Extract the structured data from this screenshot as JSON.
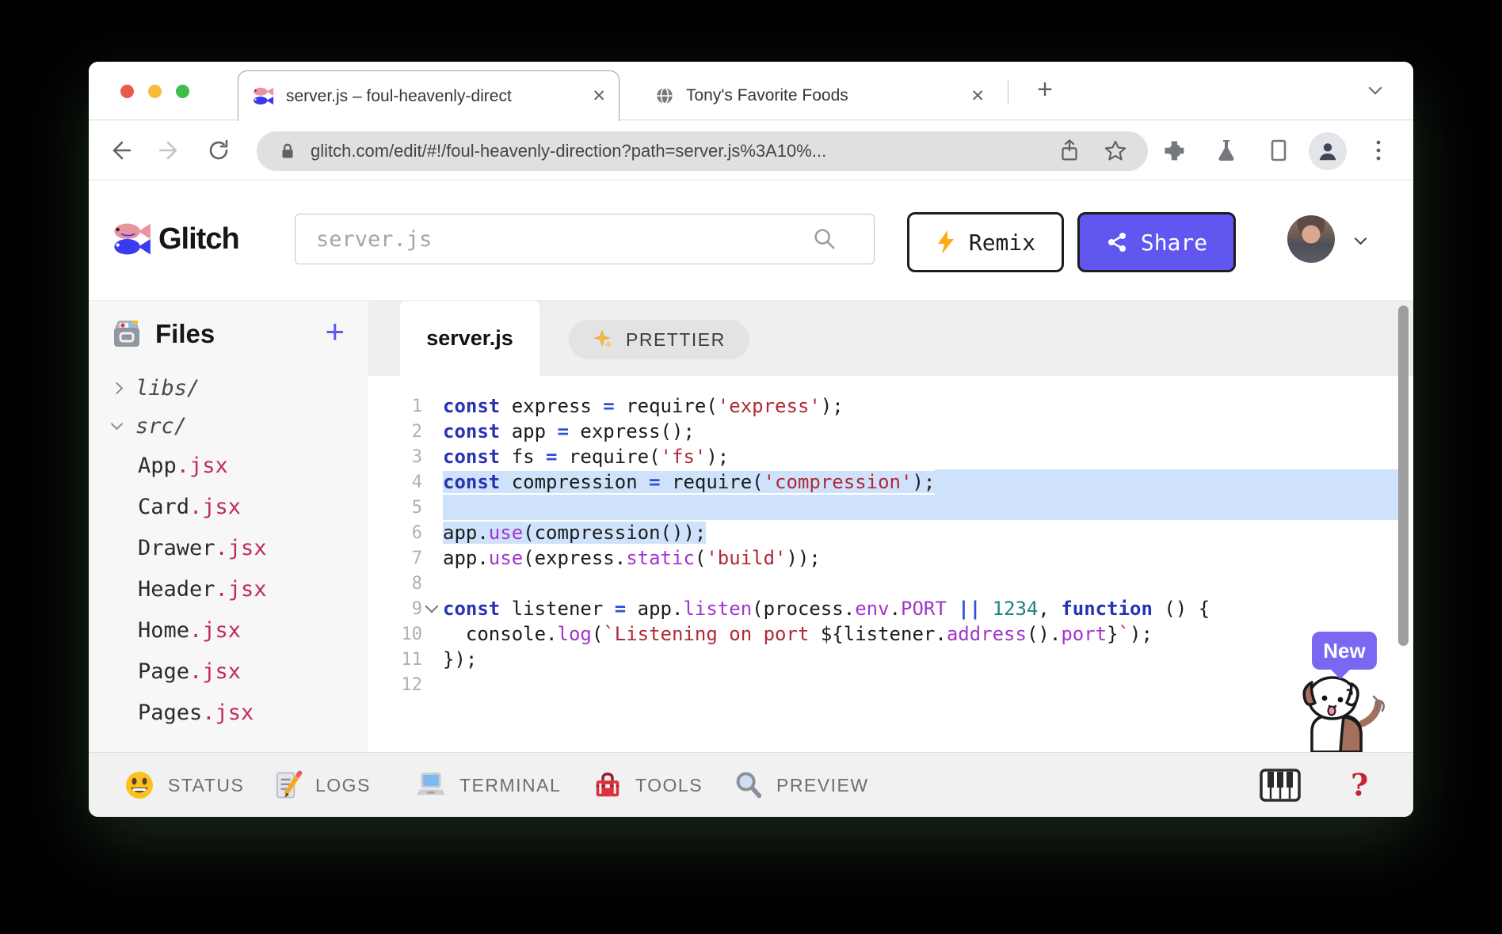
{
  "browser": {
    "tabs": [
      {
        "title": "server.js – foul-heavenly-direct",
        "active": true,
        "icon": "glitch-fish-favicon"
      },
      {
        "title": "Tony's Favorite Foods",
        "active": false,
        "icon": "globe-icon"
      }
    ],
    "close_glyph": "✕",
    "new_tab_glyph": "+",
    "url": "glitch.com/edit/#!/foul-heavenly-direction?path=server.js%3A10%..."
  },
  "header": {
    "logo_text": "Glitch",
    "search_value": "server.js",
    "remix_label": "Remix",
    "share_label": "Share"
  },
  "sidebar": {
    "title": "Files",
    "add_glyph": "+",
    "folders": [
      {
        "name": "libs/",
        "expanded": false
      },
      {
        "name": "src/",
        "expanded": true
      }
    ],
    "files": [
      {
        "base": "App",
        "ext": ".jsx"
      },
      {
        "base": "Card",
        "ext": ".jsx"
      },
      {
        "base": "Drawer",
        "ext": ".jsx"
      },
      {
        "base": "Header",
        "ext": ".jsx"
      },
      {
        "base": "Home",
        "ext": ".jsx"
      },
      {
        "base": "Page",
        "ext": ".jsx"
      },
      {
        "base": "Pages",
        "ext": ".jsx"
      }
    ]
  },
  "editor": {
    "tab_label": "server.js",
    "prettier_label": "PRETTIER",
    "lines": [
      {
        "n": 1,
        "sel": null,
        "fold": false,
        "tokens": [
          [
            "k",
            "const"
          ],
          [
            "p",
            " express "
          ],
          [
            "o",
            "="
          ],
          [
            "p",
            " require("
          ],
          [
            "s",
            "'express'"
          ],
          [
            "p",
            ");"
          ]
        ]
      },
      {
        "n": 2,
        "sel": null,
        "fold": false,
        "tokens": [
          [
            "k",
            "const"
          ],
          [
            "p",
            " app "
          ],
          [
            "o",
            "="
          ],
          [
            "p",
            " express();"
          ]
        ]
      },
      {
        "n": 3,
        "sel": null,
        "fold": false,
        "tokens": [
          [
            "k",
            "const"
          ],
          [
            "p",
            " fs "
          ],
          [
            "o",
            "="
          ],
          [
            "p",
            " require("
          ],
          [
            "s",
            "'fs'"
          ],
          [
            "p",
            ");"
          ]
        ]
      },
      {
        "n": 4,
        "sel": "full",
        "fold": false,
        "tokens": [
          [
            "k",
            "const"
          ],
          [
            "p",
            " compression "
          ],
          [
            "o",
            "="
          ],
          [
            "p",
            " require("
          ],
          [
            "s",
            "'compression'"
          ],
          [
            "p",
            ");"
          ]
        ]
      },
      {
        "n": 5,
        "sel": "full",
        "fold": false,
        "tokens": []
      },
      {
        "n": 6,
        "sel": "text",
        "fold": false,
        "tokens": [
          [
            "p",
            "app."
          ],
          [
            "f",
            "use"
          ],
          [
            "p",
            "(compression());"
          ]
        ]
      },
      {
        "n": 7,
        "sel": null,
        "fold": false,
        "tokens": [
          [
            "p",
            "app."
          ],
          [
            "f",
            "use"
          ],
          [
            "p",
            "(express."
          ],
          [
            "f",
            "static"
          ],
          [
            "p",
            "("
          ],
          [
            "s",
            "'build'"
          ],
          [
            "p",
            "));"
          ]
        ]
      },
      {
        "n": 8,
        "sel": null,
        "fold": false,
        "tokens": []
      },
      {
        "n": 9,
        "sel": null,
        "fold": true,
        "tokens": [
          [
            "k",
            "const"
          ],
          [
            "p",
            " listener "
          ],
          [
            "o",
            "="
          ],
          [
            "p",
            " app."
          ],
          [
            "f",
            "listen"
          ],
          [
            "p",
            "(process."
          ],
          [
            "f",
            "env"
          ],
          [
            "p",
            "."
          ],
          [
            "f",
            "PORT"
          ],
          [
            "p",
            " "
          ],
          [
            "o",
            "||"
          ],
          [
            "p",
            " "
          ],
          [
            "n",
            "1234"
          ],
          [
            "p",
            ", "
          ],
          [
            "k",
            "function"
          ],
          [
            "p",
            " () {"
          ]
        ]
      },
      {
        "n": 10,
        "sel": null,
        "fold": false,
        "tokens": [
          [
            "p",
            "  console."
          ],
          [
            "f",
            "log"
          ],
          [
            "p",
            "("
          ],
          [
            "s",
            "`Listening on port "
          ],
          [
            "p",
            "${listener."
          ],
          [
            "f",
            "address"
          ],
          [
            "p",
            "()."
          ],
          [
            "f",
            "port"
          ],
          [
            "p",
            "}"
          ],
          [
            "s",
            "`"
          ],
          [
            "p",
            ");"
          ]
        ]
      },
      {
        "n": 11,
        "sel": null,
        "fold": false,
        "tokens": [
          [
            "p",
            "});"
          ]
        ]
      },
      {
        "n": 12,
        "sel": null,
        "fold": false,
        "tokens": []
      }
    ]
  },
  "statusbar": {
    "items": [
      {
        "label": "STATUS"
      },
      {
        "label": "LOGS"
      },
      {
        "label": "TERMINAL"
      },
      {
        "label": "TOOLS"
      },
      {
        "label": "PREVIEW"
      }
    ],
    "help_glyph": "?"
  },
  "badge": {
    "label": "New"
  },
  "colors": {
    "accent_purple": "#6156f0",
    "badge_purple": "#7a68f2",
    "jsx_pink": "#c0295f",
    "selection_blue": "#cfe2fb",
    "token_keyword": "#2733b3",
    "token_operator": "#2d50d8",
    "token_string": "#b02a35",
    "token_property": "#a335cc",
    "token_number": "#207f87"
  }
}
